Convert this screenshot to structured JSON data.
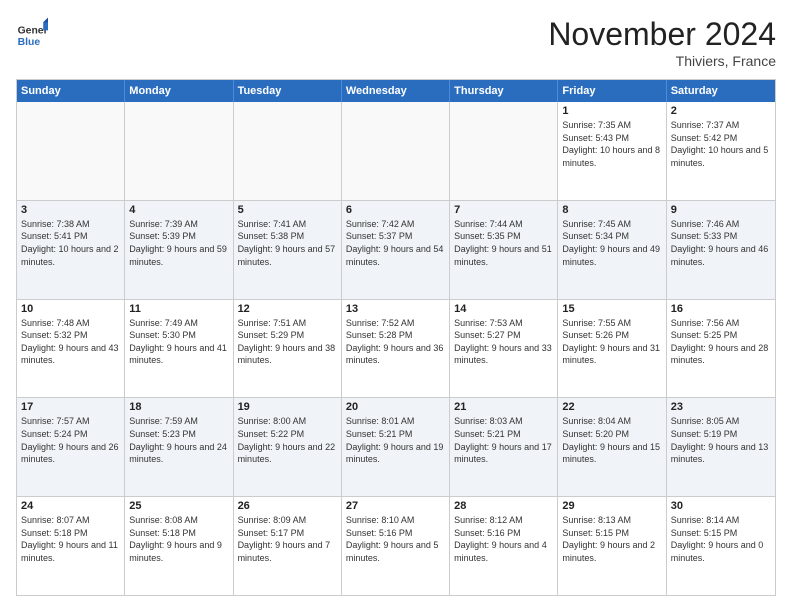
{
  "logo": {
    "general": "General",
    "blue": "Blue"
  },
  "header": {
    "month": "November 2024",
    "location": "Thiviers, France"
  },
  "weekdays": [
    "Sunday",
    "Monday",
    "Tuesday",
    "Wednesday",
    "Thursday",
    "Friday",
    "Saturday"
  ],
  "rows": [
    {
      "alt": false,
      "cells": [
        {
          "empty": true,
          "day": "",
          "sunrise": "",
          "sunset": "",
          "daylight": ""
        },
        {
          "empty": true,
          "day": "",
          "sunrise": "",
          "sunset": "",
          "daylight": ""
        },
        {
          "empty": true,
          "day": "",
          "sunrise": "",
          "sunset": "",
          "daylight": ""
        },
        {
          "empty": true,
          "day": "",
          "sunrise": "",
          "sunset": "",
          "daylight": ""
        },
        {
          "empty": true,
          "day": "",
          "sunrise": "",
          "sunset": "",
          "daylight": ""
        },
        {
          "empty": false,
          "day": "1",
          "sunrise": "Sunrise: 7:35 AM",
          "sunset": "Sunset: 5:43 PM",
          "daylight": "Daylight: 10 hours and 8 minutes."
        },
        {
          "empty": false,
          "day": "2",
          "sunrise": "Sunrise: 7:37 AM",
          "sunset": "Sunset: 5:42 PM",
          "daylight": "Daylight: 10 hours and 5 minutes."
        }
      ]
    },
    {
      "alt": true,
      "cells": [
        {
          "empty": false,
          "day": "3",
          "sunrise": "Sunrise: 7:38 AM",
          "sunset": "Sunset: 5:41 PM",
          "daylight": "Daylight: 10 hours and 2 minutes."
        },
        {
          "empty": false,
          "day": "4",
          "sunrise": "Sunrise: 7:39 AM",
          "sunset": "Sunset: 5:39 PM",
          "daylight": "Daylight: 9 hours and 59 minutes."
        },
        {
          "empty": false,
          "day": "5",
          "sunrise": "Sunrise: 7:41 AM",
          "sunset": "Sunset: 5:38 PM",
          "daylight": "Daylight: 9 hours and 57 minutes."
        },
        {
          "empty": false,
          "day": "6",
          "sunrise": "Sunrise: 7:42 AM",
          "sunset": "Sunset: 5:37 PM",
          "daylight": "Daylight: 9 hours and 54 minutes."
        },
        {
          "empty": false,
          "day": "7",
          "sunrise": "Sunrise: 7:44 AM",
          "sunset": "Sunset: 5:35 PM",
          "daylight": "Daylight: 9 hours and 51 minutes."
        },
        {
          "empty": false,
          "day": "8",
          "sunrise": "Sunrise: 7:45 AM",
          "sunset": "Sunset: 5:34 PM",
          "daylight": "Daylight: 9 hours and 49 minutes."
        },
        {
          "empty": false,
          "day": "9",
          "sunrise": "Sunrise: 7:46 AM",
          "sunset": "Sunset: 5:33 PM",
          "daylight": "Daylight: 9 hours and 46 minutes."
        }
      ]
    },
    {
      "alt": false,
      "cells": [
        {
          "empty": false,
          "day": "10",
          "sunrise": "Sunrise: 7:48 AM",
          "sunset": "Sunset: 5:32 PM",
          "daylight": "Daylight: 9 hours and 43 minutes."
        },
        {
          "empty": false,
          "day": "11",
          "sunrise": "Sunrise: 7:49 AM",
          "sunset": "Sunset: 5:30 PM",
          "daylight": "Daylight: 9 hours and 41 minutes."
        },
        {
          "empty": false,
          "day": "12",
          "sunrise": "Sunrise: 7:51 AM",
          "sunset": "Sunset: 5:29 PM",
          "daylight": "Daylight: 9 hours and 38 minutes."
        },
        {
          "empty": false,
          "day": "13",
          "sunrise": "Sunrise: 7:52 AM",
          "sunset": "Sunset: 5:28 PM",
          "daylight": "Daylight: 9 hours and 36 minutes."
        },
        {
          "empty": false,
          "day": "14",
          "sunrise": "Sunrise: 7:53 AM",
          "sunset": "Sunset: 5:27 PM",
          "daylight": "Daylight: 9 hours and 33 minutes."
        },
        {
          "empty": false,
          "day": "15",
          "sunrise": "Sunrise: 7:55 AM",
          "sunset": "Sunset: 5:26 PM",
          "daylight": "Daylight: 9 hours and 31 minutes."
        },
        {
          "empty": false,
          "day": "16",
          "sunrise": "Sunrise: 7:56 AM",
          "sunset": "Sunset: 5:25 PM",
          "daylight": "Daylight: 9 hours and 28 minutes."
        }
      ]
    },
    {
      "alt": true,
      "cells": [
        {
          "empty": false,
          "day": "17",
          "sunrise": "Sunrise: 7:57 AM",
          "sunset": "Sunset: 5:24 PM",
          "daylight": "Daylight: 9 hours and 26 minutes."
        },
        {
          "empty": false,
          "day": "18",
          "sunrise": "Sunrise: 7:59 AM",
          "sunset": "Sunset: 5:23 PM",
          "daylight": "Daylight: 9 hours and 24 minutes."
        },
        {
          "empty": false,
          "day": "19",
          "sunrise": "Sunrise: 8:00 AM",
          "sunset": "Sunset: 5:22 PM",
          "daylight": "Daylight: 9 hours and 22 minutes."
        },
        {
          "empty": false,
          "day": "20",
          "sunrise": "Sunrise: 8:01 AM",
          "sunset": "Sunset: 5:21 PM",
          "daylight": "Daylight: 9 hours and 19 minutes."
        },
        {
          "empty": false,
          "day": "21",
          "sunrise": "Sunrise: 8:03 AM",
          "sunset": "Sunset: 5:21 PM",
          "daylight": "Daylight: 9 hours and 17 minutes."
        },
        {
          "empty": false,
          "day": "22",
          "sunrise": "Sunrise: 8:04 AM",
          "sunset": "Sunset: 5:20 PM",
          "daylight": "Daylight: 9 hours and 15 minutes."
        },
        {
          "empty": false,
          "day": "23",
          "sunrise": "Sunrise: 8:05 AM",
          "sunset": "Sunset: 5:19 PM",
          "daylight": "Daylight: 9 hours and 13 minutes."
        }
      ]
    },
    {
      "alt": false,
      "cells": [
        {
          "empty": false,
          "day": "24",
          "sunrise": "Sunrise: 8:07 AM",
          "sunset": "Sunset: 5:18 PM",
          "daylight": "Daylight: 9 hours and 11 minutes."
        },
        {
          "empty": false,
          "day": "25",
          "sunrise": "Sunrise: 8:08 AM",
          "sunset": "Sunset: 5:18 PM",
          "daylight": "Daylight: 9 hours and 9 minutes."
        },
        {
          "empty": false,
          "day": "26",
          "sunrise": "Sunrise: 8:09 AM",
          "sunset": "Sunset: 5:17 PM",
          "daylight": "Daylight: 9 hours and 7 minutes."
        },
        {
          "empty": false,
          "day": "27",
          "sunrise": "Sunrise: 8:10 AM",
          "sunset": "Sunset: 5:16 PM",
          "daylight": "Daylight: 9 hours and 5 minutes."
        },
        {
          "empty": false,
          "day": "28",
          "sunrise": "Sunrise: 8:12 AM",
          "sunset": "Sunset: 5:16 PM",
          "daylight": "Daylight: 9 hours and 4 minutes."
        },
        {
          "empty": false,
          "day": "29",
          "sunrise": "Sunrise: 8:13 AM",
          "sunset": "Sunset: 5:15 PM",
          "daylight": "Daylight: 9 hours and 2 minutes."
        },
        {
          "empty": false,
          "day": "30",
          "sunrise": "Sunrise: 8:14 AM",
          "sunset": "Sunset: 5:15 PM",
          "daylight": "Daylight: 9 hours and 0 minutes."
        }
      ]
    }
  ]
}
